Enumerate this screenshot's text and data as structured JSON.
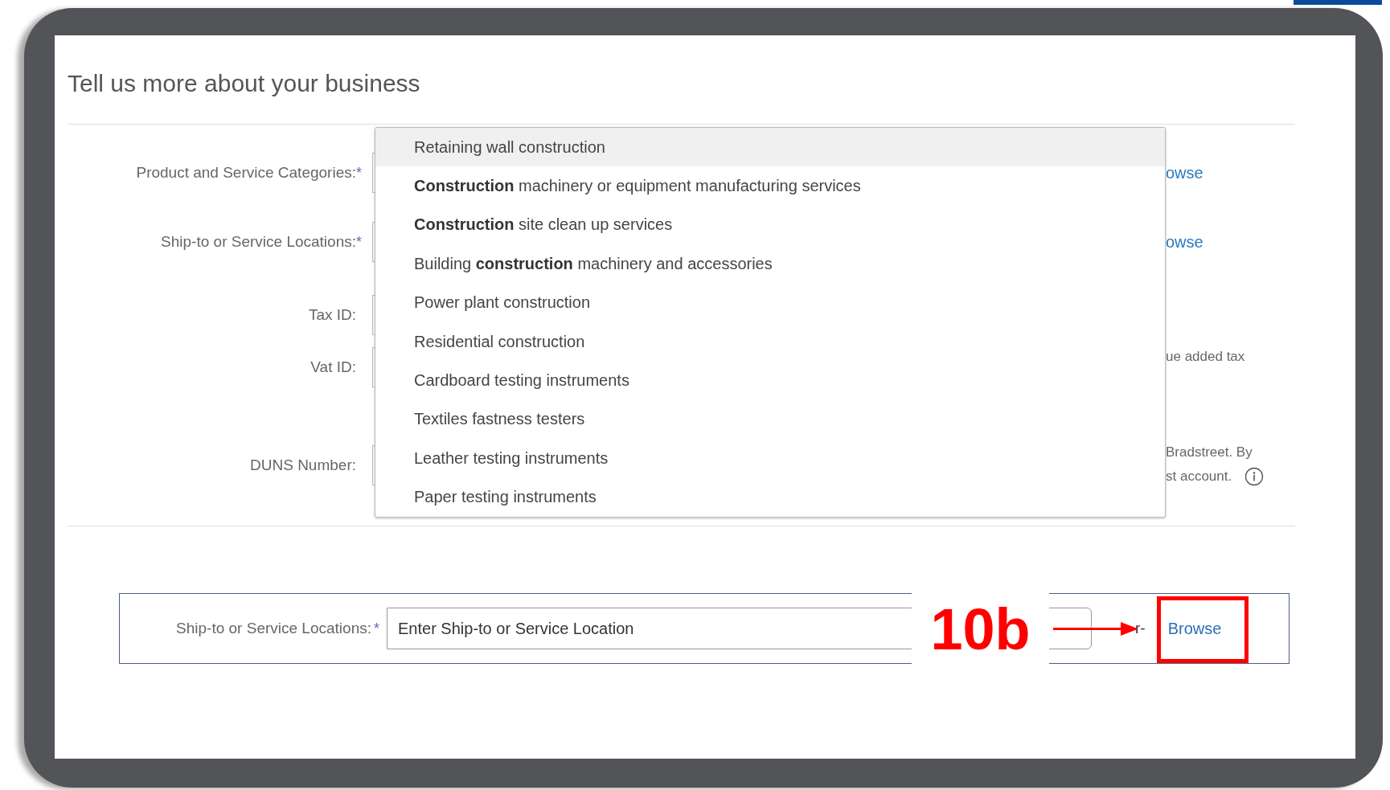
{
  "title": "Tell us more about your business",
  "form_rows": [
    {
      "label": "Product and Service Categories:",
      "asterisk": "*",
      "side_link": "owse"
    },
    {
      "label": "Ship-to or Service Locations:",
      "asterisk": "*",
      "side_link": "owse"
    },
    {
      "label": "Tax ID:"
    },
    {
      "label": "Vat ID:",
      "side_hint": [
        "ue added tax"
      ]
    },
    {
      "label": "DUNS Number:",
      "side_hint": [
        "Bradstreet. By",
        "st account."
      ],
      "info_icon": true
    }
  ],
  "dropdown": [
    {
      "label": "Retaining wall construction",
      "selected": true
    },
    {
      "label": "**Construction** machinery or equipment manufacturing services",
      "selected": false
    },
    {
      "label": "**Construction** site clean up services",
      "selected": false
    },
    {
      "label": "Building **construction** machinery and accessories",
      "selected": false
    },
    {
      "label": "Power plant construction",
      "selected": false
    },
    {
      "label": "Residential construction",
      "selected": false
    },
    {
      "label": "Cardboard testing instruments",
      "selected": false
    },
    {
      "label": "Textiles fastness testers",
      "selected": false
    },
    {
      "label": "Leather testing instruments",
      "selected": false
    },
    {
      "label": "Paper testing instruments",
      "selected": false
    }
  ],
  "callout": {
    "label": "Ship-to or Service Locations:",
    "asterisk": "*",
    "placeholder": "Enter Ship-to or Service Location",
    "separator": "r-",
    "link": "Browse",
    "step": "10b"
  }
}
